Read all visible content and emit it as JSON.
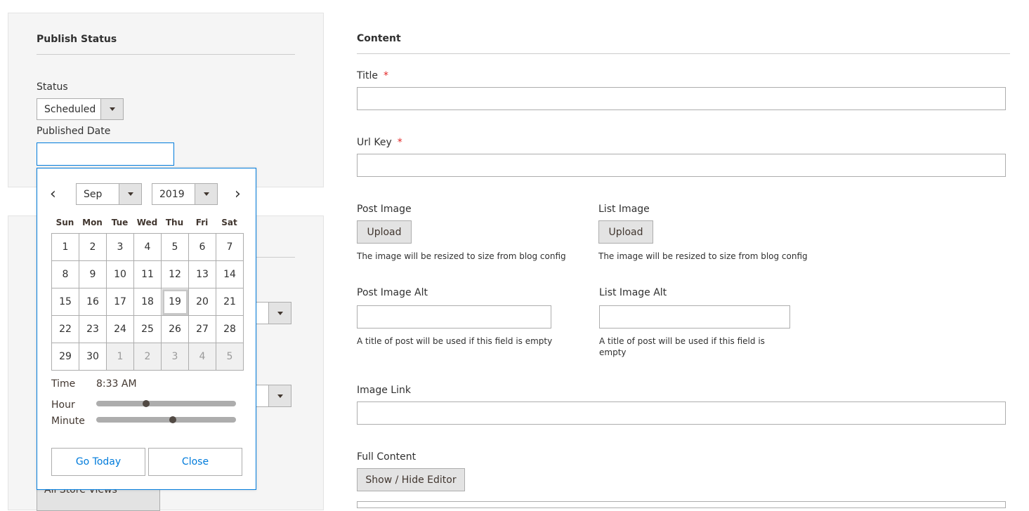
{
  "publish_status": {
    "title": "Publish Status",
    "status_label": "Status",
    "status_value": "Scheduled",
    "published_date_label": "Published Date",
    "published_date_value": ""
  },
  "store_view_partial": "All Store Views",
  "datepicker": {
    "month": "Sep",
    "year": "2019",
    "prev_arrow": "‹",
    "next_arrow": "›",
    "weekdays": [
      "Sun",
      "Mon",
      "Tue",
      "Wed",
      "Thu",
      "Fri",
      "Sat"
    ],
    "weeks": [
      [
        "1",
        "2",
        "3",
        "4",
        "5",
        "6",
        "7"
      ],
      [
        "8",
        "9",
        "10",
        "11",
        "12",
        "13",
        "14"
      ],
      [
        "15",
        "16",
        "17",
        "18",
        "19",
        "20",
        "21"
      ],
      [
        "22",
        "23",
        "24",
        "25",
        "26",
        "27",
        "28"
      ],
      [
        "29",
        "30",
        "1",
        "2",
        "3",
        "4",
        "5"
      ]
    ],
    "time_label": "Time",
    "time_value": "8:33 AM",
    "hour_label": "Hour",
    "minute_label": "Minute",
    "hour_fraction": 0.35,
    "minute_fraction": 0.55,
    "go_today_label": "Go Today",
    "close_label": "Close"
  },
  "content": {
    "title": "Content",
    "title_label": "Title",
    "required_mark": "*",
    "url_key_label": "Url Key",
    "post_image_label": "Post Image",
    "list_image_label": "List Image",
    "upload_label": "Upload",
    "resize_note": "The image will be resized to size from blog config",
    "post_image_alt_label": "Post Image Alt",
    "list_image_alt_label": "List Image Alt",
    "alt_note_left": "A title of post will be used if this field is empty",
    "alt_note_right_line1": "A title of post will be used if this field is",
    "alt_note_right_line2": "empty",
    "image_link_label": "Image Link",
    "full_content_label": "Full Content",
    "toggle_editor_label": "Show / Hide Editor"
  },
  "colors": {
    "accent_blue": "#007bdb",
    "required_red": "#e22626",
    "panel_bg": "#f5f5f5"
  }
}
